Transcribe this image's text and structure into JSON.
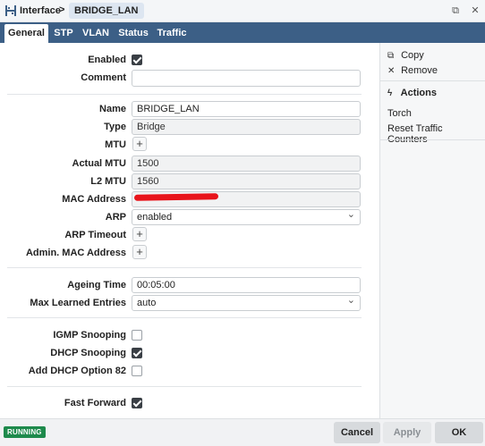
{
  "titlebar": {
    "title": "Interface",
    "separator": ">",
    "item_name": "BRIDGE_LAN",
    "restore_glyph": "⧉",
    "close_glyph": "✕"
  },
  "tabs": [
    {
      "label": "General",
      "active": true
    },
    {
      "label": "STP",
      "active": false
    },
    {
      "label": "VLAN",
      "active": false
    },
    {
      "label": "Status",
      "active": false
    },
    {
      "label": "Traffic",
      "active": false
    }
  ],
  "form": {
    "enabled": {
      "label": "Enabled",
      "checked": true
    },
    "comment": {
      "label": "Comment",
      "value": ""
    },
    "name": {
      "label": "Name",
      "value": "BRIDGE_LAN"
    },
    "type": {
      "label": "Type",
      "value": "Bridge"
    },
    "mtu": {
      "label": "MTU"
    },
    "actual_mtu": {
      "label": "Actual MTU",
      "value": "1500"
    },
    "l2_mtu": {
      "label": "L2 MTU",
      "value": "1560"
    },
    "mac_address": {
      "label": "MAC Address",
      "value": ""
    },
    "arp": {
      "label": "ARP",
      "value": "enabled"
    },
    "arp_timeout": {
      "label": "ARP Timeout"
    },
    "admin_mac": {
      "label": "Admin. MAC Address"
    },
    "ageing_time": {
      "label": "Ageing Time",
      "value": "00:05:00"
    },
    "max_learned": {
      "label": "Max Learned Entries",
      "value": "auto"
    },
    "igmp_snooping": {
      "label": "IGMP Snooping",
      "checked": false
    },
    "dhcp_snooping": {
      "label": "DHCP Snooping",
      "checked": true
    },
    "dhcp_option82": {
      "label": "Add DHCP Option 82",
      "checked": false
    },
    "fast_forward": {
      "label": "Fast Forward",
      "checked": true
    },
    "plus_glyph": "+"
  },
  "sidebar": {
    "copy_label": "Copy",
    "remove_label": "Remove",
    "actions_heading": "Actions",
    "torch_label": "Torch",
    "reset_label": "Reset Traffic Counters",
    "copy_icon": "⧉",
    "remove_icon": "✕",
    "actions_icon": "ϟ"
  },
  "footer": {
    "status": "RUNNING",
    "status_color": "#1e8a4c",
    "cancel_label": "Cancel",
    "apply_label": "Apply",
    "ok_label": "OK"
  },
  "colors": {
    "tabbar": "#3c5f86",
    "redaction": "#e8141b"
  }
}
